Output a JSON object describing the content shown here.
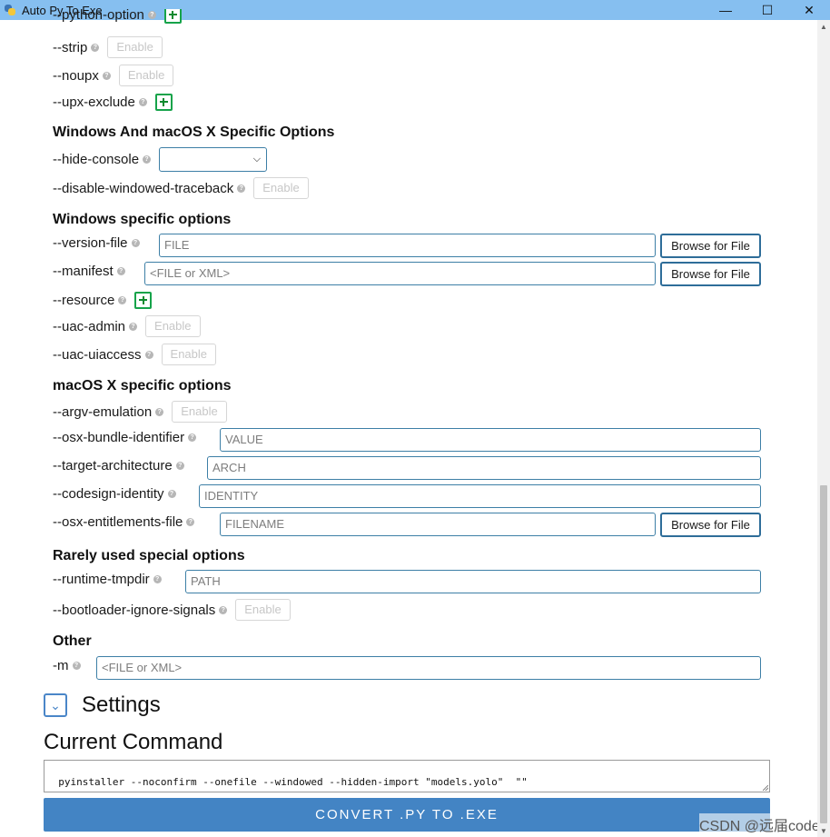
{
  "window": {
    "title": "Auto Py To Exe",
    "minimize": "—",
    "maximize": "☐",
    "close": "✕"
  },
  "help_glyph": "?",
  "enable_label": "Enable",
  "browse_label": "Browse for File",
  "top": {
    "python_option": "--python-option",
    "strip": "--strip",
    "noupx": "--noupx",
    "upx_exclude": "--upx-exclude"
  },
  "win_mac": {
    "heading": "Windows And macOS X Specific Options",
    "hide_console": "--hide-console",
    "hide_console_value": "",
    "disable_tb": "--disable-windowed-traceback"
  },
  "windows": {
    "heading": "Windows specific options",
    "version_file": "--version-file",
    "version_file_placeholder": "FILE",
    "manifest": "--manifest",
    "manifest_placeholder": "<FILE or XML>",
    "resource": "--resource",
    "uac_admin": "--uac-admin",
    "uac_uiaccess": "--uac-uiaccess"
  },
  "macos": {
    "heading": "macOS X specific options",
    "argv_emulation": "--argv-emulation",
    "bundle_identifier": "--osx-bundle-identifier",
    "bundle_identifier_placeholder": "VALUE",
    "target_arch": "--target-architecture",
    "target_arch_placeholder": "ARCH",
    "codesign": "--codesign-identity",
    "codesign_placeholder": "IDENTITY",
    "entitlements": "--osx-entitlements-file",
    "entitlements_placeholder": "FILENAME"
  },
  "rare": {
    "heading": "Rarely used special options",
    "runtime_tmpdir": "--runtime-tmpdir",
    "runtime_tmpdir_placeholder": "PATH",
    "bootloader_ignore": "--bootloader-ignore-signals"
  },
  "other": {
    "heading": "Other",
    "m": "-m",
    "m_placeholder": "<FILE or XML>"
  },
  "settings": {
    "label": "Settings",
    "toggle_glyph": "⌄"
  },
  "command": {
    "heading": "Current Command",
    "text": "pyinstaller --noconfirm --onefile --windowed --hidden-import \"models.yolo\"  \"\""
  },
  "convert_label": "CONVERT .PY TO .EXE",
  "watermark": "CSDN @远届code"
}
